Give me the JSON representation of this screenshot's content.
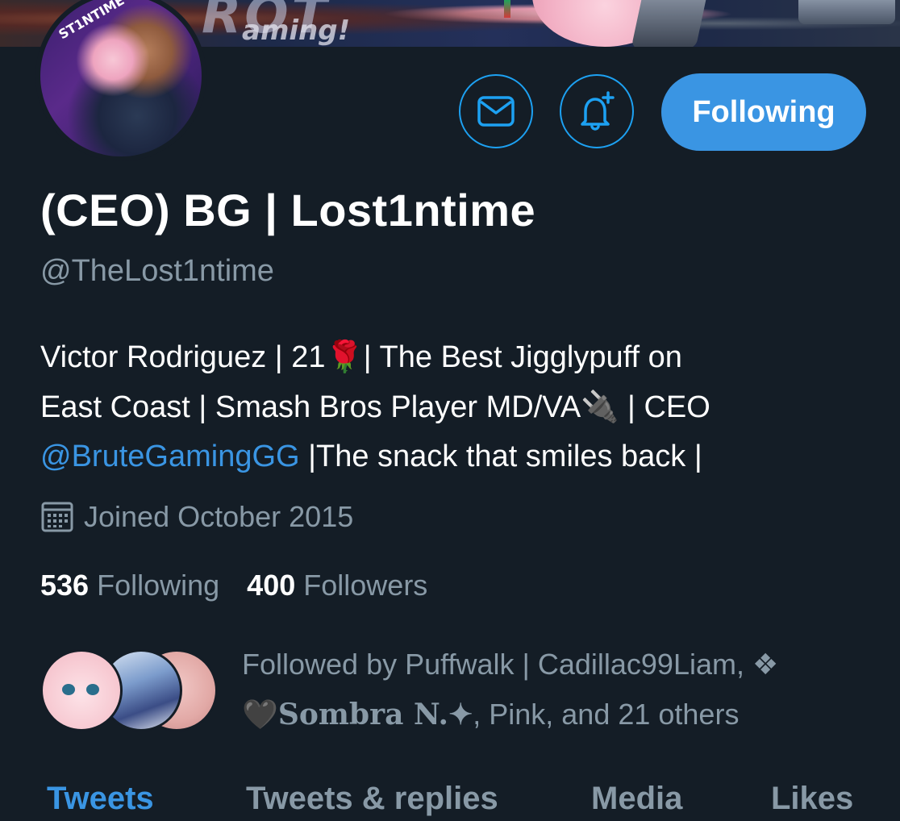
{
  "banner": {
    "text": "ROT",
    "subtext": "aming!"
  },
  "avatar": {
    "label": "ST1NTIME"
  },
  "actions": {
    "message_icon": "envelope-icon",
    "notify_icon": "bell-plus-icon",
    "following_label": "Following",
    "accent_color": "#3a95e3"
  },
  "profile": {
    "display_name": "(CEO) BG | Lost1ntime",
    "handle": "@TheLost1ntime",
    "bio": {
      "line1_a": "Victor Rodriguez | 21",
      "line1_rose": "🌹",
      "line1_b": "| The Best Jigglypuff on",
      "line2_a": "East Coast | Smash Bros Player MD/VA",
      "line2_plug": "🔌",
      "line2_b": " | CEO",
      "line3_mention": "@BruteGamingGG",
      "line3_b": " |The snack that smiles back |"
    },
    "joined_icon": "calendar-icon",
    "joined": "Joined October 2015"
  },
  "stats": {
    "following_count": "536",
    "following_label": "Following",
    "followers_count": "400",
    "followers_label": "Followers"
  },
  "followed_by": {
    "line1": "Followed by Puffwalk | Cadillac99Liam, ❖",
    "line2_heart": "🖤",
    "line2_sombra": "Sombra N.✦",
    "line2_rest": ", Pink, and 21 others"
  },
  "tabs": [
    {
      "label": "Tweets",
      "active": true
    },
    {
      "label": "Tweets & replies",
      "active": false
    },
    {
      "label": "Media",
      "active": false
    },
    {
      "label": "Likes",
      "active": false
    }
  ]
}
